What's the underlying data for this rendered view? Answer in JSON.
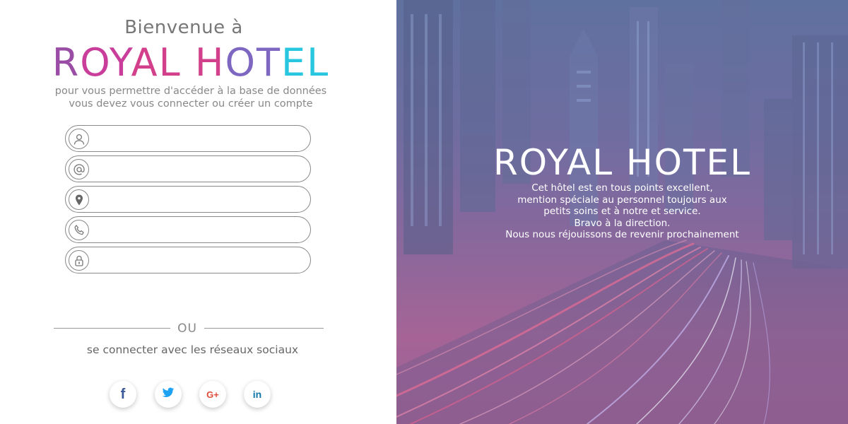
{
  "left": {
    "welcome": "Bienvenue à",
    "brand_letters": [
      "R",
      "O",
      "Y",
      "A",
      "L",
      " ",
      "H",
      "O",
      "T",
      "E",
      "L"
    ],
    "subtitle_line1": "pour vous permettre d'accéder à la base de données",
    "subtitle_line2": "vous devez vous connecter ou créer un compte",
    "fields": [
      {
        "icon": "user-icon",
        "value": ""
      },
      {
        "icon": "at-icon",
        "value": ""
      },
      {
        "icon": "location-icon",
        "value": ""
      },
      {
        "icon": "phone-icon",
        "value": ""
      },
      {
        "icon": "lock-icon",
        "value": ""
      }
    ],
    "divider_text": "OU",
    "social_text": "se connecter avec les réseaux sociaux",
    "social": [
      {
        "name": "facebook",
        "glyph": "f",
        "color": "#3b5998"
      },
      {
        "name": "twitter",
        "glyph": "🐦",
        "color": "#1da1f2"
      },
      {
        "name": "google-plus",
        "glyph": "G+",
        "color": "#dd4b39"
      },
      {
        "name": "linkedin",
        "glyph": "in",
        "color": "#0e76a8"
      }
    ]
  },
  "right": {
    "title": "ROYAL HOTEL",
    "desc_line1": "Cet hôtel est en tous points excellent,",
    "desc_line2": "mention spéciale au personnel toujours aux",
    "desc_line3": "petits soins et à notre et service.",
    "desc_line4": "Bravo à la direction.",
    "desc_line5": "Nous nous réjouissons de revenir prochainement"
  },
  "colors": {
    "brand_gradient": [
      "#9a4da5",
      "#c93e9b",
      "#d2408c",
      "#7d67c0",
      "#29c7df"
    ],
    "overlay_top": "#5a6f9a",
    "overlay_bottom": "#b0608f"
  }
}
